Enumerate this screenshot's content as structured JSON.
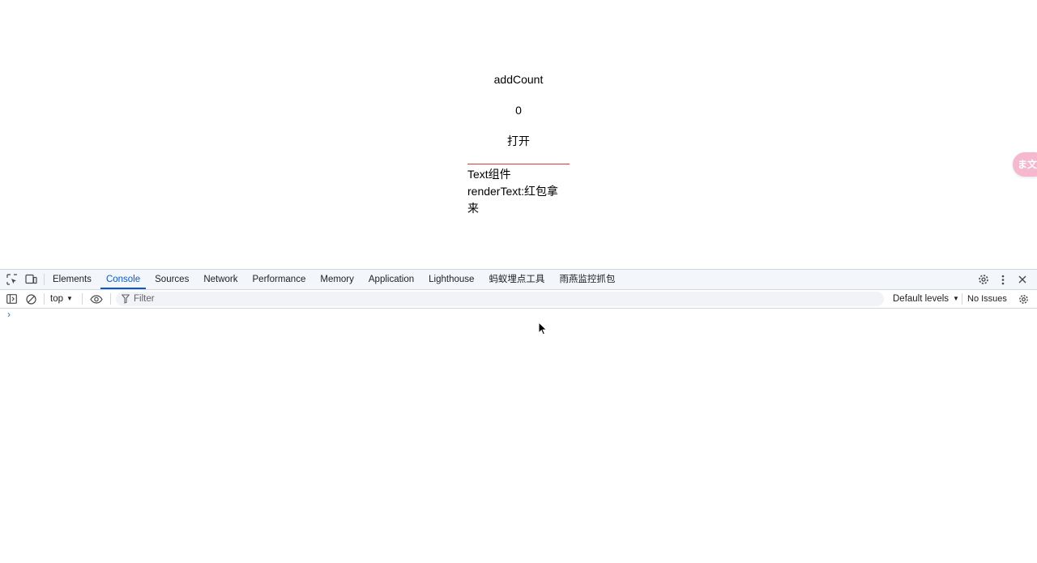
{
  "page": {
    "add_count_label": "addCount",
    "count_value": "0",
    "open_label": "打开",
    "text_component_title": "Text组件",
    "render_text_line": "renderText:红包拿来",
    "translate_badge": "ま文"
  },
  "devtools": {
    "tabs": [
      {
        "label": "Elements",
        "active": false
      },
      {
        "label": "Console",
        "active": true
      },
      {
        "label": "Sources",
        "active": false
      },
      {
        "label": "Network",
        "active": false
      },
      {
        "label": "Performance",
        "active": false
      },
      {
        "label": "Memory",
        "active": false
      },
      {
        "label": "Application",
        "active": false
      },
      {
        "label": "Lighthouse",
        "active": false
      },
      {
        "label": "蚂蚁埋点工具",
        "active": false
      },
      {
        "label": "雨燕监控抓包",
        "active": false
      }
    ],
    "console": {
      "context": "top",
      "filter_placeholder": "Filter",
      "levels": "Default levels",
      "issues": "No Issues",
      "prompt": "›"
    },
    "accent_color": "#0b57d0"
  }
}
